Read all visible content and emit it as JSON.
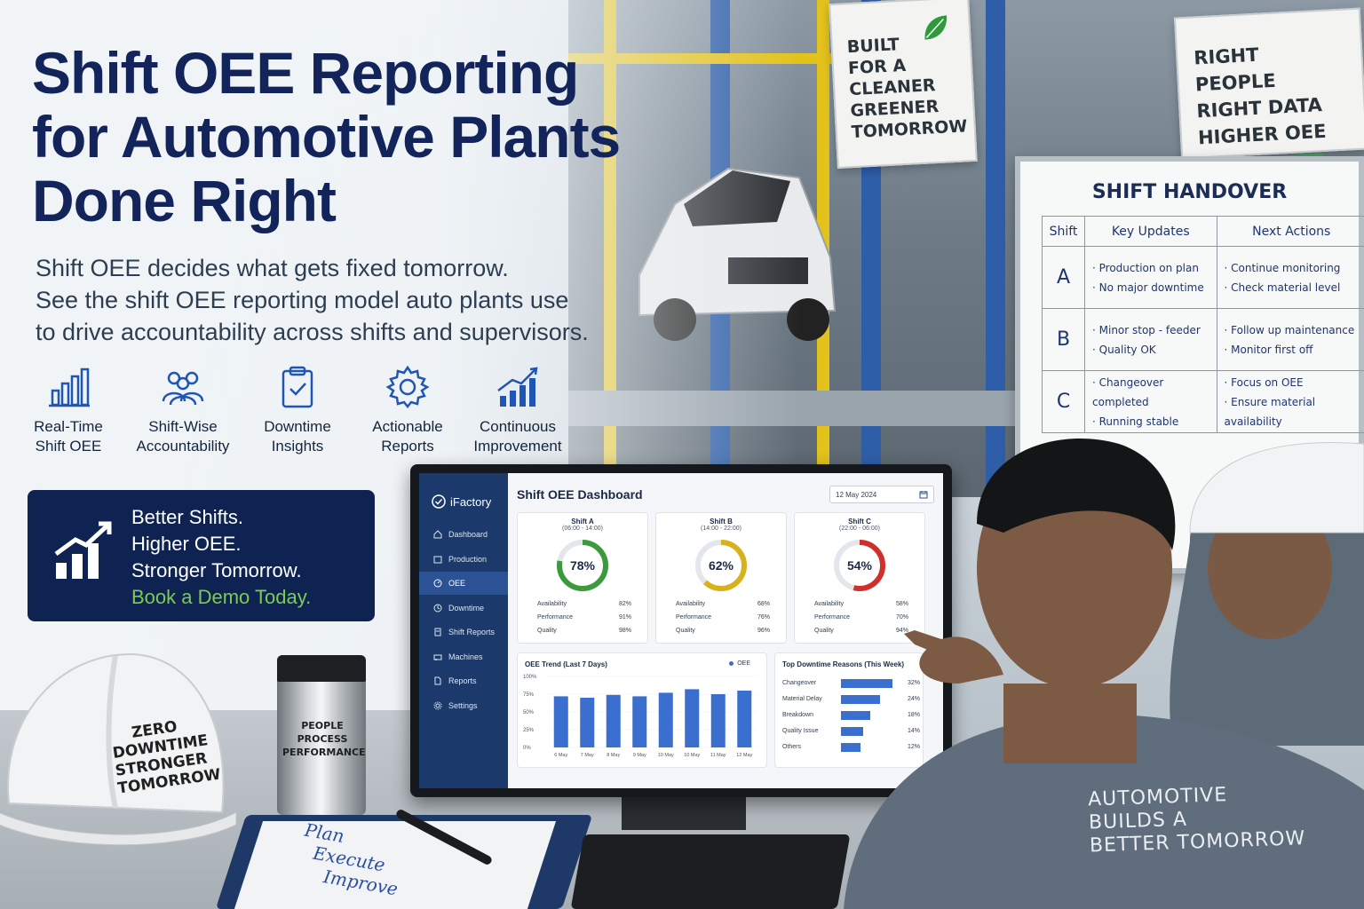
{
  "hero": {
    "headline": [
      "Shift OEE Reporting",
      "for Automotive Plants",
      "Done Right"
    ],
    "subcopy": [
      "Shift OEE decides what gets fixed tomorrow.",
      "See the shift OEE reporting model auto plants use",
      "to drive accountability across shifts and supervisors."
    ]
  },
  "features": [
    {
      "icon": "bar-chart-icon",
      "lines": [
        "Real-Time",
        "Shift OEE"
      ]
    },
    {
      "icon": "team-icon",
      "lines": [
        "Shift-Wise",
        "Accountability"
      ]
    },
    {
      "icon": "clipboard-check-icon",
      "lines": [
        "Downtime",
        "Insights"
      ]
    },
    {
      "icon": "gear-icon",
      "lines": [
        "Actionable",
        "Reports"
      ]
    },
    {
      "icon": "growth-chart-icon",
      "lines": [
        "Continuous",
        "Improvement"
      ]
    }
  ],
  "cta": {
    "lines": [
      "Better Shifts.",
      "Higher OEE.",
      "Stronger Tomorrow."
    ],
    "demo": "Book a Demo Today.",
    "bg": "#0f2352",
    "accent": "#7ccb52"
  },
  "signs": {
    "left": [
      "BUILT",
      "FOR A",
      "CLEANER",
      "GREENER",
      "TOMORROW"
    ],
    "right": [
      "RIGHT PEOPLE",
      "RIGHT DATA",
      "HIGHER OEE"
    ]
  },
  "board": {
    "title": "SHIFT HANDOVER",
    "headers": [
      "Shift",
      "Key Updates",
      "Next Actions"
    ],
    "rows": [
      {
        "shift": "A",
        "updates": [
          "· Production on plan",
          "· No major downtime"
        ],
        "actions": [
          "· Continue monitoring",
          "· Check material level"
        ]
      },
      {
        "shift": "B",
        "updates": [
          "· Minor stop - feeder",
          "· Quality OK"
        ],
        "actions": [
          "· Follow up maintenance",
          "· Monitor first off"
        ]
      },
      {
        "shift": "C",
        "updates": [
          "· Changeover completed",
          "· Running stable"
        ],
        "actions": [
          "· Focus on OEE",
          "· Ensure material availability"
        ]
      }
    ]
  },
  "dashboard": {
    "brand": "iFactory",
    "title": "Shift OEE Dashboard",
    "date": "12 May 2024",
    "nav": [
      {
        "label": "Dashboard",
        "icon": "home-icon",
        "active": false
      },
      {
        "label": "Production",
        "icon": "box-icon",
        "active": false
      },
      {
        "label": "OEE",
        "icon": "gauge-icon",
        "active": true
      },
      {
        "label": "Downtime",
        "icon": "clock-icon",
        "active": false
      },
      {
        "label": "Shift Reports",
        "icon": "report-icon",
        "active": false
      },
      {
        "label": "Machines",
        "icon": "machine-icon",
        "active": false
      },
      {
        "label": "Reports",
        "icon": "file-icon",
        "active": false
      },
      {
        "label": "Settings",
        "icon": "gear-icon",
        "active": false
      }
    ],
    "shifts": [
      {
        "name": "Shift A",
        "time": "(06:00 - 14:00)",
        "oee": "78%",
        "pct": 78,
        "color": "#3a9a3c",
        "availability": "82%",
        "performance": "91%",
        "quality": "98%"
      },
      {
        "name": "Shift B",
        "time": "(14:00 - 22:00)",
        "oee": "62%",
        "pct": 62,
        "color": "#d8b21b",
        "availability": "68%",
        "performance": "76%",
        "quality": "96%"
      },
      {
        "name": "Shift C",
        "time": "(22:00 - 06:00)",
        "oee": "54%",
        "pct": 54,
        "color": "#d0302c",
        "availability": "58%",
        "performance": "70%",
        "quality": "94%"
      }
    ],
    "metric_labels": {
      "availability": "Availability",
      "performance": "Performance",
      "quality": "Quality"
    },
    "downtime": {
      "title": "Top Downtime Reasons (This Week)",
      "items": [
        {
          "label": "Changeover",
          "value": "32%",
          "pct": 32
        },
        {
          "label": "Material Delay",
          "value": "24%",
          "pct": 24
        },
        {
          "label": "Breakdown",
          "value": "18%",
          "pct": 18
        },
        {
          "label": "Quality Issue",
          "value": "14%",
          "pct": 14
        },
        {
          "label": "Others",
          "value": "12%",
          "pct": 12
        }
      ]
    }
  },
  "chart_data": {
    "type": "bar",
    "title": "OEE Trend (Last 7 Days)",
    "categories": [
      "6 May",
      "7 May",
      "8 May",
      "9 May",
      "10 May",
      "10 May",
      "11 May",
      "12 May"
    ],
    "series": [
      {
        "name": "OEE",
        "values": [
          72,
          70,
          74,
          72,
          77,
          82,
          75,
          80
        ]
      }
    ],
    "yticks": [
      "0%",
      "25%",
      "50%",
      "75%",
      "100%"
    ],
    "ylim": [
      0,
      100
    ],
    "color": "#3a6fcf"
  },
  "props": {
    "helmet": [
      "ZERO",
      "DOWNTIME",
      "STRONGER",
      "TOMORROW"
    ],
    "mug": [
      "PEOPLE",
      "PROCESS",
      "PERFORMANCE"
    ],
    "notepad": [
      "Plan",
      "Execute",
      "Improve"
    ],
    "jacket": [
      "AUTOMOTIVE",
      "BUILDS A",
      "BETTER TOMORROW"
    ]
  }
}
